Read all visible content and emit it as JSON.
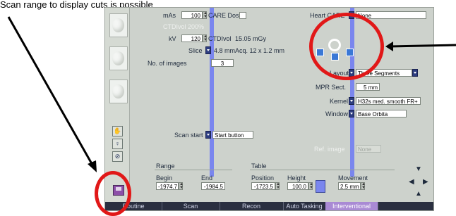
{
  "overlay_text": {
    "top_caption": "Scan range to display cuts is possible"
  },
  "params": {
    "mas_label": "mAs",
    "mas_value": "100",
    "care_dose_label": "CARE Dose",
    "ghost_ref": "CTDIvol 200%",
    "kv_label": "kV",
    "kv_value": "120",
    "ctdivol_label": "CTDIvol",
    "ctdivol_value": "15.05 mGy",
    "slice_label": "Slice",
    "slice_value": "4.8 mm",
    "acq_text": "Acq. 12 x 1.2 mm",
    "images_label": "No. of images",
    "images_value": "3",
    "scan_start_label": "Scan start",
    "scan_start_value": "Start button"
  },
  "right_params": {
    "heart_label": "Heart CARE",
    "heart_value": "None",
    "layout_label": "Layout",
    "layout_value": "Three Segments",
    "mpr_label": "MPR Sect.",
    "mpr_value": "5 mm",
    "kernel_label": "Kernel",
    "kernel_value": "H32s med. smooth FR+",
    "window_label": "Window",
    "window_value": "Base Orbita",
    "ref_label": "Ref. image",
    "ref_value": "None"
  },
  "range": {
    "title": "Range",
    "begin_label": "Begin",
    "begin_value": "-1974.7",
    "end_label": "End",
    "end_value": "-1984.5"
  },
  "table": {
    "title": "Table",
    "position_label": "Position",
    "position_value": "-1723.5",
    "height_label": "Height",
    "height_value": "100.0",
    "movement_label": "Movement",
    "movement_value": "2.5 mm"
  },
  "tabs": [
    {
      "label": "Routine"
    },
    {
      "label": "Scan"
    },
    {
      "label": "Recon"
    },
    {
      "label": "Auto Tasking"
    },
    {
      "label": "Interventional"
    }
  ],
  "colors": {
    "panel_bg": "#cdd2cc",
    "highlight_bar": "#7a86ee",
    "annotation_red": "#e11818",
    "active_tab": "#a98ad4"
  }
}
